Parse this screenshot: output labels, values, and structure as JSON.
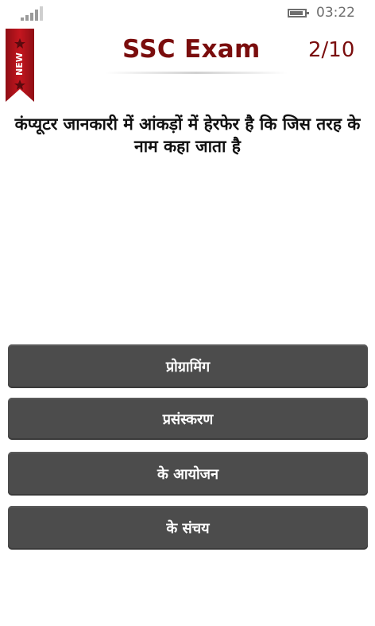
{
  "status_bar": {
    "time": "03:22",
    "signal_icon": "signal-strength-icon",
    "battery_icon": "battery-icon"
  },
  "ribbon": {
    "label": "NEW",
    "color": "#b5121b"
  },
  "header": {
    "title": "SSC Exam",
    "progress": "2/10"
  },
  "question": {
    "text": "कंप्यूटर जानकारी में आंकड़ों में हेरफेर है कि जिस तरह के नाम कहा जाता है"
  },
  "options": [
    {
      "label": "प्रोग्रामिंग"
    },
    {
      "label": "प्रसंस्करण"
    },
    {
      "label": "के आयोजन"
    },
    {
      "label": "के संचय"
    }
  ],
  "colors": {
    "accent": "#7a0d0d",
    "option_bg": "#4c4c4c",
    "option_text": "#ffffff"
  }
}
